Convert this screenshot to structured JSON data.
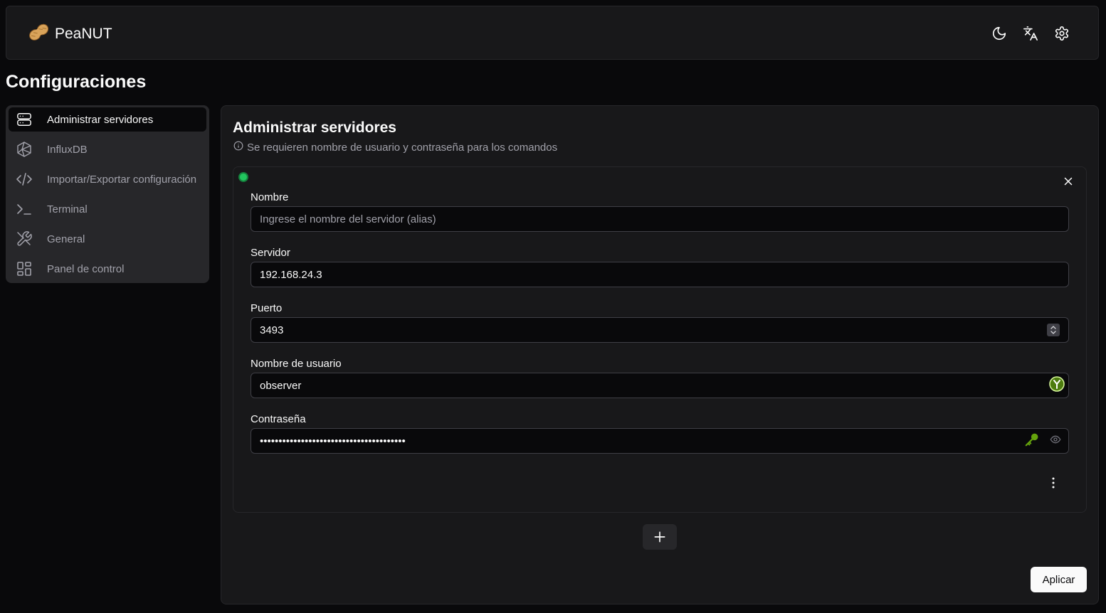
{
  "app": {
    "name": "PeaNUT",
    "logo_icon": "peanut-icon"
  },
  "header": {
    "icons": [
      "moon-icon",
      "translate-icon",
      "gear-icon"
    ]
  },
  "page": {
    "title": "Configuraciones"
  },
  "sidebar": {
    "items": [
      {
        "label": "Administrar servidores",
        "icon": "server-icon",
        "active": true
      },
      {
        "label": "InfluxDB",
        "icon": "influxdb-icon",
        "active": false
      },
      {
        "label": "Importar/Exportar configuración",
        "icon": "code-icon",
        "active": false
      },
      {
        "label": "Terminal",
        "icon": "terminal-icon",
        "active": false
      },
      {
        "label": "General",
        "icon": "tools-icon",
        "active": false
      },
      {
        "label": "Panel de control",
        "icon": "dashboard-icon",
        "active": false
      }
    ]
  },
  "main": {
    "title": "Administrar servidores",
    "hint": "Se requieren nombre de usuario y contraseña para los comandos",
    "server": {
      "status_color": "#22c55e",
      "fields": {
        "name": {
          "label": "Nombre",
          "value": "",
          "placeholder": "Ingrese el nombre del servidor (alias)"
        },
        "host": {
          "label": "Servidor",
          "value": "192.168.24.3",
          "placeholder": ""
        },
        "port": {
          "label": "Puerto",
          "value": "3493",
          "placeholder": ""
        },
        "username": {
          "label": "Nombre de usuario",
          "value": "observer",
          "placeholder": ""
        },
        "password": {
          "label": "Contraseña",
          "value": "observerpasswordvalue1234567890abcdefgh",
          "placeholder": ""
        }
      }
    },
    "apply_label": "Aplicar"
  },
  "colors": {
    "background": "#09090b",
    "card": "#18181a",
    "border": "#27272a",
    "accent_green": "#22c55e",
    "key_green": "#65a30d"
  }
}
